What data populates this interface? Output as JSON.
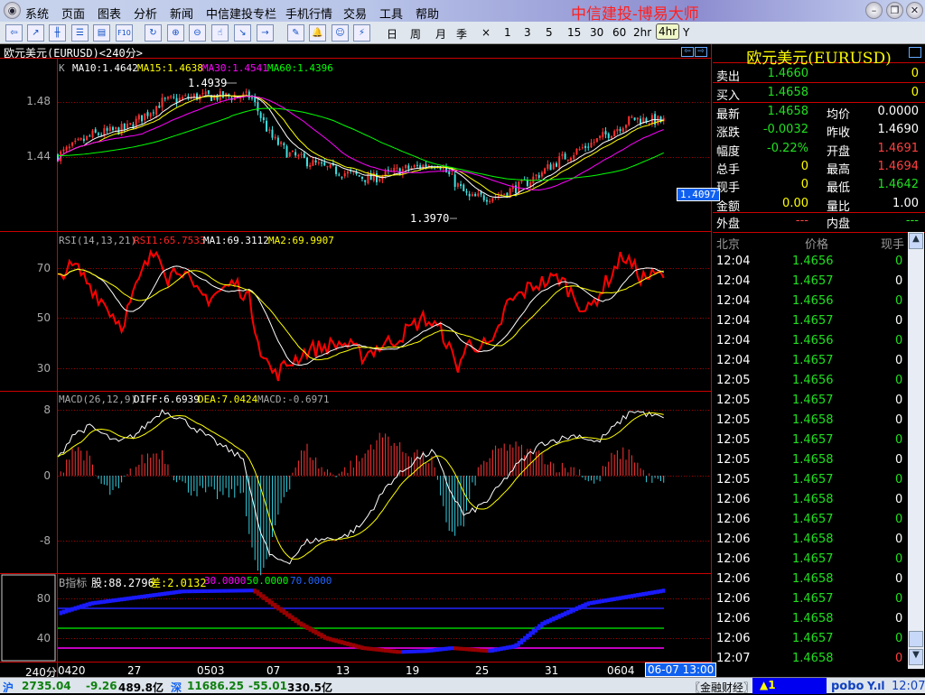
{
  "menu": [
    "系统",
    "页面",
    "图表",
    "分析",
    "新闻",
    "中信建投专栏",
    "手机行情",
    "交易",
    "工具",
    "帮助"
  ],
  "brand": "中信建投-博易大师",
  "window_buttons": {
    "min": "–",
    "restore": "❐",
    "close": "✕"
  },
  "toolbar_icons": [
    "back-icon",
    "line-chart-icon",
    "candlestick-icon",
    "list-icon",
    "quote-screen-icon",
    "f10-icon",
    "refresh-icon",
    "zoom-in-icon",
    "zoom-out-icon",
    "hand-select-icon",
    "export-icon",
    "import-icon",
    "draw-pen-icon",
    "alarm-bell-icon",
    "users-icon",
    "lightning-icon"
  ],
  "toolbar_f10": "F10",
  "periods": [
    "日",
    "周",
    "月",
    "季",
    "×",
    "1",
    "3",
    "5",
    "15",
    "30",
    "60",
    "2hr",
    "4hr",
    "Y"
  ],
  "selected_period": "4hr",
  "chart_title": "欧元美元(EURUSD)<240分>",
  "main": {
    "k": "K",
    "ma10": "MA10:1.4642",
    "ma15": "MA15:1.4638",
    "ma30": "MA30:1.4541",
    "ma60": "MA60:1.4396",
    "high_mark": "1.4939",
    "low_mark": "1.3970",
    "current_price": "1.4097",
    "yticks": [
      "1.48",
      "1.44"
    ]
  },
  "rsi": {
    "name": "RSI(14,13,21)",
    "rsi1": "RSI1:65.7533",
    "ma1": "MA1:69.3112",
    "ma2": "MA2:69.9907",
    "yticks": [
      "70",
      "50",
      "30"
    ]
  },
  "macd": {
    "name": "MACD(26,12,9)",
    "diff": "DIFF:6.6939",
    "dea": "DEA:7.0424",
    "macd": "MACD:-0.6971",
    "yticks": [
      "8",
      "0",
      "-8"
    ]
  },
  "bind": {
    "name": "B指标",
    "gu": "股:88.2796",
    "cha": "差:2.0132",
    "l30": "30.0000",
    "l50": "50.0000",
    "l70": "70.0000",
    "yticks": [
      "80",
      "40"
    ]
  },
  "xaxis": {
    "period": "240分",
    "dates": [
      "0420",
      "27",
      "0503",
      "07",
      "13",
      "19",
      "25",
      "31",
      "0604"
    ],
    "cursor": "06-07 13:00"
  },
  "chart_data": {
    "type": "candlestick",
    "price_path": [
      [
        0,
        1.441
      ],
      [
        3,
        1.456
      ],
      [
        6,
        1.461
      ],
      [
        9,
        1.48
      ],
      [
        12,
        1.484
      ],
      [
        15.3,
        1.484
      ],
      [
        16.7,
        1.484
      ],
      [
        18.4,
        1.455
      ],
      [
        20,
        1.442
      ],
      [
        23.1,
        1.432
      ],
      [
        27,
        1.424
      ],
      [
        29.4,
        1.43
      ],
      [
        32.9,
        1.436
      ],
      [
        34.5,
        1.42
      ],
      [
        35.6,
        1.41
      ],
      [
        38,
        1.412
      ],
      [
        40.3,
        1.42
      ],
      [
        43.4,
        1.438
      ],
      [
        46.6,
        1.452
      ],
      [
        49.7,
        1.468
      ],
      [
        52.4,
        1.466
      ]
    ],
    "rsi_path": [
      [
        0,
        65
      ],
      [
        0.5,
        69
      ],
      [
        1.6,
        70
      ],
      [
        5.5,
        47
      ],
      [
        7.5,
        70
      ],
      [
        8.7,
        78
      ],
      [
        9.5,
        66
      ],
      [
        10.6,
        71
      ],
      [
        11.8,
        60
      ],
      [
        13,
        58
      ],
      [
        15.3,
        64
      ],
      [
        16.5,
        58
      ],
      [
        17.7,
        35
      ],
      [
        18.8,
        27
      ],
      [
        20,
        32
      ],
      [
        21.6,
        37
      ],
      [
        24.7,
        40
      ],
      [
        26.3,
        35
      ],
      [
        29.4,
        42
      ],
      [
        31.7,
        50
      ],
      [
        33.3,
        44
      ],
      [
        34.5,
        30
      ],
      [
        35.6,
        40
      ],
      [
        37.6,
        38
      ],
      [
        38.8,
        55
      ],
      [
        41.1,
        63
      ],
      [
        43.4,
        66
      ],
      [
        45.8,
        52
      ],
      [
        48.9,
        75
      ],
      [
        50.5,
        66
      ],
      [
        52.4,
        67
      ]
    ],
    "diff_path": [
      [
        0,
        2
      ],
      [
        1.25,
        5
      ],
      [
        2.8,
        6
      ],
      [
        5.2,
        4
      ],
      [
        6.7,
        5
      ],
      [
        9.1,
        8
      ],
      [
        10.6,
        7
      ],
      [
        13.75,
        4
      ],
      [
        16.1,
        2
      ],
      [
        17.3,
        -6
      ],
      [
        18.4,
        -10
      ],
      [
        20,
        -10.5
      ],
      [
        21.6,
        -8
      ],
      [
        24.7,
        -7.5
      ],
      [
        26.3,
        -6
      ],
      [
        28.6,
        -1
      ],
      [
        31,
        2
      ],
      [
        32.5,
        3
      ],
      [
        34,
        -2
      ],
      [
        35.2,
        -5
      ],
      [
        37.2,
        -3
      ],
      [
        39.5,
        1
      ],
      [
        41.9,
        4
      ],
      [
        45,
        5
      ],
      [
        46.6,
        4
      ],
      [
        49.7,
        8
      ],
      [
        52.4,
        7
      ]
    ],
    "b_path": [
      [
        0,
        65
      ],
      [
        2.8,
        75
      ],
      [
        10.6,
        87
      ],
      [
        16.9,
        88
      ],
      [
        18.4,
        75
      ],
      [
        20.8,
        55
      ],
      [
        23.1,
        40
      ],
      [
        26.3,
        30
      ],
      [
        29.4,
        26
      ],
      [
        31.7,
        27
      ],
      [
        34,
        30
      ],
      [
        37.2,
        27
      ],
      [
        39.5,
        32
      ],
      [
        41.9,
        55
      ],
      [
        45.8,
        75
      ],
      [
        52.4,
        88
      ]
    ],
    "price_range": [
      1.3862,
      1.5121
    ],
    "rsi_range": [
      15,
      82
    ],
    "macd_range": [
      -11.7,
      11.4
    ],
    "b_range": [
      20,
      105
    ]
  },
  "quote": {
    "title": "欧元美元(EURUSD)",
    "sell": {
      "label": "卖出",
      "price": "1.4660",
      "vol": "0"
    },
    "buy": {
      "label": "买入",
      "price": "1.4658",
      "vol": "0"
    },
    "stats": [
      {
        "l": "最新",
        "v": "1.4658",
        "c": "#20e020",
        "l2": "均价",
        "v2": "0.0000",
        "c2": "#fff"
      },
      {
        "l": "涨跌",
        "v": "-0.0032",
        "c": "#20e020",
        "l2": "昨收",
        "v2": "1.4690",
        "c2": "#fff"
      },
      {
        "l": "幅度",
        "v": "-0.22%",
        "c": "#20e020",
        "l2": "开盘",
        "v2": "1.4691",
        "c2": "#ff4040"
      },
      {
        "l": "总手",
        "v": "0",
        "c": "#ffff00",
        "l2": "最高",
        "v2": "1.4694",
        "c2": "#ff4040"
      },
      {
        "l": "现手",
        "v": "0",
        "c": "#ffff00",
        "l2": "最低",
        "v2": "1.4642",
        "c2": "#20e020"
      },
      {
        "l": "金额",
        "v": "0.00",
        "c": "#ffff00",
        "l2": "量比",
        "v2": "1.00",
        "c2": "#fff"
      }
    ],
    "outer": {
      "label": "外盘",
      "value": "---"
    },
    "inner": {
      "label": "内盘",
      "value": "---"
    },
    "tick_headers": [
      "北京",
      "价格",
      "现手"
    ],
    "ticks": [
      {
        "t": "12:04",
        "p": "1.4656",
        "v": "0",
        "c": "#20e020"
      },
      {
        "t": "12:04",
        "p": "1.4657",
        "v": "0",
        "c": "#fff"
      },
      {
        "t": "12:04",
        "p": "1.4656",
        "v": "0",
        "c": "#20e020"
      },
      {
        "t": "12:04",
        "p": "1.4657",
        "v": "0",
        "c": "#fff"
      },
      {
        "t": "12:04",
        "p": "1.4656",
        "v": "0",
        "c": "#20e020"
      },
      {
        "t": "12:04",
        "p": "1.4657",
        "v": "0",
        "c": "#fff"
      },
      {
        "t": "12:05",
        "p": "1.4656",
        "v": "0",
        "c": "#20e020"
      },
      {
        "t": "12:05",
        "p": "1.4657",
        "v": "0",
        "c": "#fff"
      },
      {
        "t": "12:05",
        "p": "1.4658",
        "v": "0",
        "c": "#fff"
      },
      {
        "t": "12:05",
        "p": "1.4657",
        "v": "0",
        "c": "#20e020"
      },
      {
        "t": "12:05",
        "p": "1.4658",
        "v": "0",
        "c": "#fff"
      },
      {
        "t": "12:05",
        "p": "1.4657",
        "v": "0",
        "c": "#20e020"
      },
      {
        "t": "12:06",
        "p": "1.4658",
        "v": "0",
        "c": "#fff"
      },
      {
        "t": "12:06",
        "p": "1.4657",
        "v": "0",
        "c": "#20e020"
      },
      {
        "t": "12:06",
        "p": "1.4658",
        "v": "0",
        "c": "#fff"
      },
      {
        "t": "12:06",
        "p": "1.4657",
        "v": "0",
        "c": "#20e020"
      },
      {
        "t": "12:06",
        "p": "1.4658",
        "v": "0",
        "c": "#fff"
      },
      {
        "t": "12:06",
        "p": "1.4657",
        "v": "0",
        "c": "#20e020"
      },
      {
        "t": "12:06",
        "p": "1.4658",
        "v": "0",
        "c": "#fff"
      },
      {
        "t": "12:06",
        "p": "1.4657",
        "v": "0",
        "c": "#20e020"
      },
      {
        "t": "12:07",
        "p": "1.4658",
        "v": "0",
        "c": "#ff4040"
      }
    ]
  },
  "status": {
    "sh_label": "沪",
    "sh_index": "2735.04",
    "sh_change": "-9.26",
    "sh_amount": "489.8亿",
    "sz_label": "深",
    "sz_index": "11686.25",
    "sz_change": "-55.01",
    "sz_amount": "330.5亿",
    "news": "〖金融财经〗",
    "alert": "▲1",
    "logo": "pobo",
    "signal": "Y.ıl",
    "time": "12:07"
  },
  "colors": {
    "up": "#ff3030",
    "down": "#40e0e0",
    "grid": "#a00000"
  }
}
